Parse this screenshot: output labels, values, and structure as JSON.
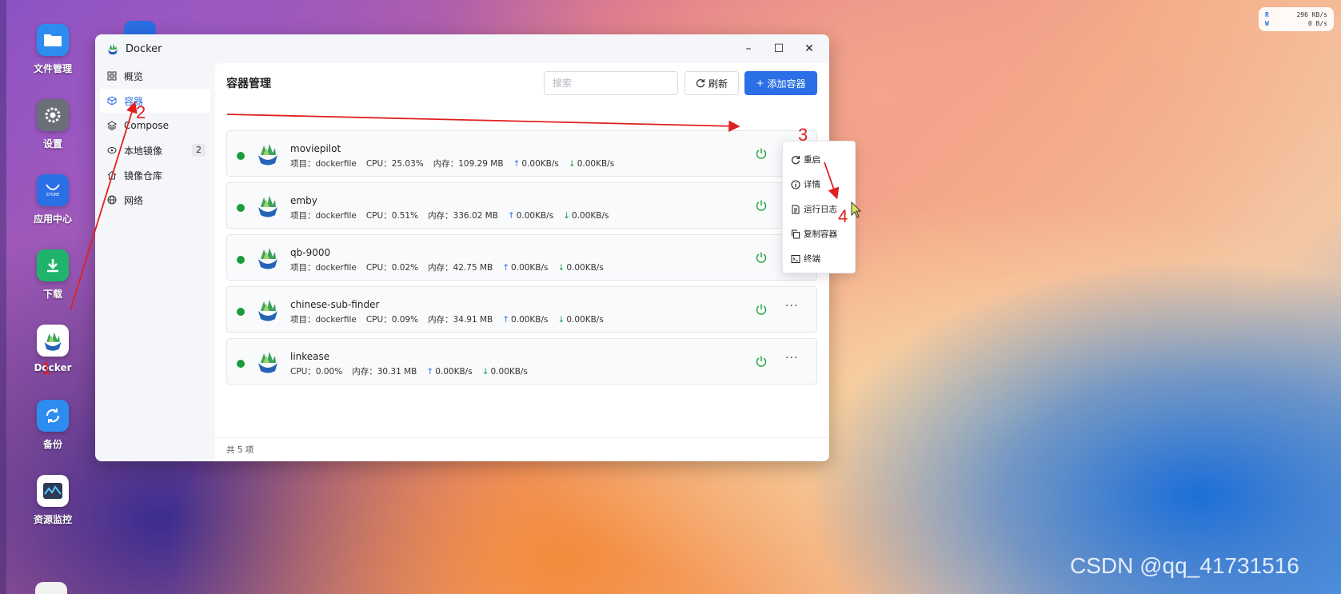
{
  "desktop": {
    "apps": [
      {
        "label": "文件管理",
        "icon": "folder-icon",
        "color": "#2d8cf0"
      },
      {
        "label": "设置",
        "icon": "gear-icon",
        "color": "#6b6f78"
      },
      {
        "label": "应用中心",
        "icon": "store-icon",
        "color": "#2a6fe6",
        "sub": "STORE"
      },
      {
        "label": "下载",
        "icon": "download-icon",
        "color": "#1fb36b"
      },
      {
        "label": "Docker",
        "icon": "docker-icon",
        "color": "#ffffff"
      },
      {
        "label": "备份",
        "icon": "backup-icon",
        "color": "#2d8cf0"
      },
      {
        "label": "资源监控",
        "icon": "monitor-icon",
        "color": "#ffffff"
      }
    ]
  },
  "speed_widget": {
    "r_label": "R",
    "r_value": "296 KB/s",
    "w_label": "W",
    "w_value": "0  B/s"
  },
  "window": {
    "title": "Docker",
    "minimize": "–",
    "maximize": "☐",
    "close": "✕"
  },
  "sidebar": {
    "items": [
      {
        "label": "概览",
        "icon": "grid-icon"
      },
      {
        "label": "容器",
        "icon": "cube-icon",
        "active": true
      },
      {
        "label": "Compose",
        "icon": "layers-icon"
      },
      {
        "label": "本地镜像",
        "icon": "disk-icon",
        "badge": "2"
      },
      {
        "label": "镜像仓库",
        "icon": "home-icon"
      },
      {
        "label": "网络",
        "icon": "globe-icon"
      }
    ]
  },
  "main": {
    "title": "容器管理",
    "search_placeholder": "搜索",
    "refresh_label": "刷新",
    "add_label": "添加容器",
    "footer": "共 5 项"
  },
  "containers": [
    {
      "name": "moviepilot",
      "project": "项目：dockerfile",
      "cpu": "CPU：25.03%",
      "mem": "内存：109.29 MB",
      "up": "0.00KB/s",
      "down": "0.00KB/s",
      "status": "running"
    },
    {
      "name": "emby",
      "project": "项目：dockerfile",
      "cpu": "CPU：0.51%",
      "mem": "内存：336.02 MB",
      "up": "0.00KB/s",
      "down": "0.00KB/s",
      "status": "running"
    },
    {
      "name": "qb-9000",
      "project": "项目：dockerfile",
      "cpu": "CPU：0.02%",
      "mem": "内存：42.75 MB",
      "up": "0.00KB/s",
      "down": "0.00KB/s",
      "status": "running"
    },
    {
      "name": "chinese-sub-finder",
      "project": "项目：dockerfile",
      "cpu": "CPU：0.09%",
      "mem": "内存：34.91 MB",
      "up": "0.00KB/s",
      "down": "0.00KB/s",
      "status": "running"
    },
    {
      "name": "linkease",
      "project": "",
      "cpu": "CPU：0.00%",
      "mem": "内存：30.31 MB",
      "up": "0.00KB/s",
      "down": "0.00KB/s",
      "status": "running"
    }
  ],
  "context_menu": {
    "items": [
      {
        "label": "重启",
        "icon": "restart-icon"
      },
      {
        "label": "详情",
        "icon": "info-icon"
      },
      {
        "label": "运行日志",
        "icon": "log-icon"
      },
      {
        "label": "复制容器",
        "icon": "copy-icon"
      },
      {
        "label": "终端",
        "icon": "terminal-icon"
      }
    ]
  },
  "annotations": {
    "step1": "1",
    "step2": "2",
    "step3": "3",
    "step4": "4"
  },
  "watermark": "CSDN @qq_41731516",
  "colors": {
    "accent": "#2a6fe6",
    "running": "#1a9c3c",
    "annotation": "#e02020"
  }
}
